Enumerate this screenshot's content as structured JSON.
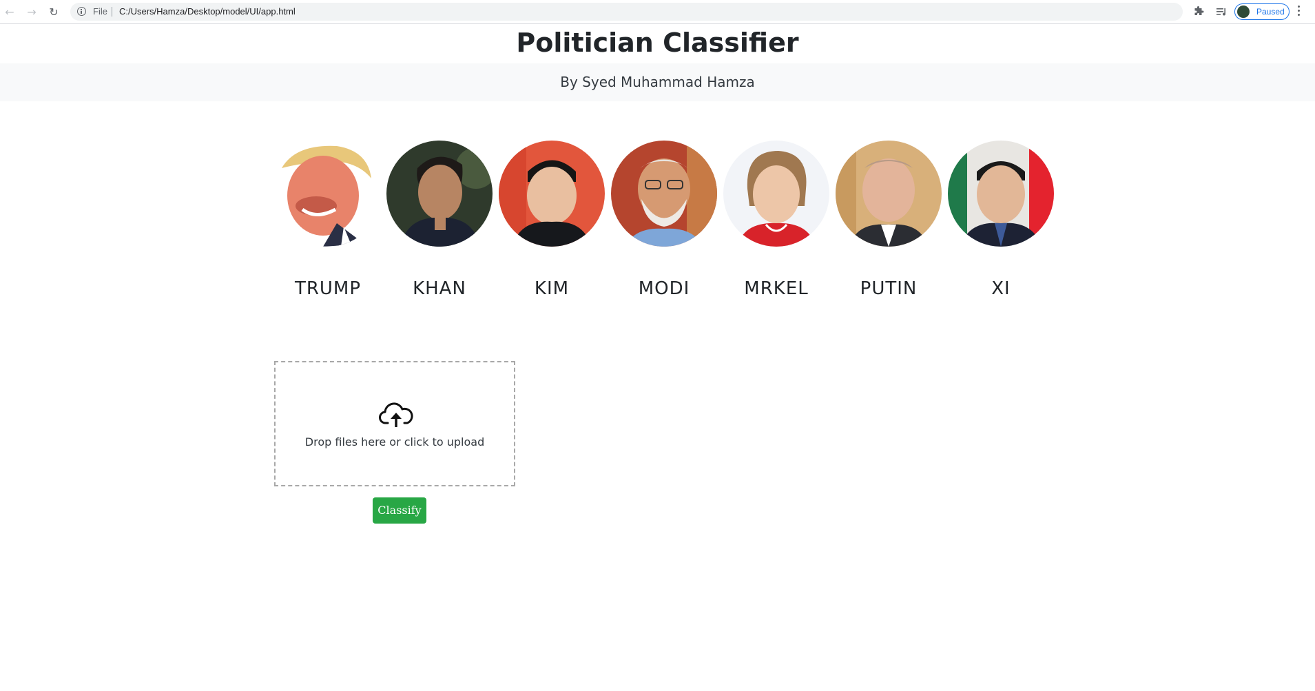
{
  "browser": {
    "scheme_label": "File",
    "url": "C:/Users/Hamza/Desktop/model/UI/app.html",
    "profile_status": "Paused"
  },
  "header": {
    "title": "Politician Classifier",
    "byline": "By Syed Muhammad Hamza"
  },
  "politicians": [
    {
      "name": "TRUMP"
    },
    {
      "name": "KHAN"
    },
    {
      "name": "KIM"
    },
    {
      "name": "MODI"
    },
    {
      "name": "MRKEL"
    },
    {
      "name": "PUTIN"
    },
    {
      "name": "XI"
    }
  ],
  "upload": {
    "icon": "cloud-upload-icon",
    "prompt": "Drop files here or click to upload"
  },
  "actions": {
    "classify_label": "Classify"
  },
  "colors": {
    "classify_button": "#28a745",
    "byline_background": "#f8f9fa",
    "dropzone_border": "#a8a8a8"
  }
}
